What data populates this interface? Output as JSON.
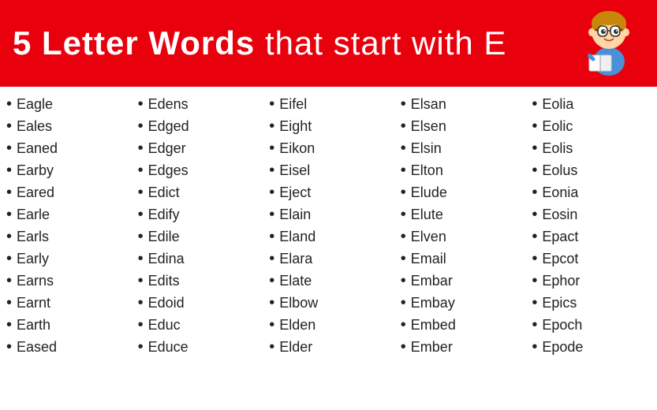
{
  "header": {
    "title_bold": "5 Letter Words",
    "title_normal": " that start with E"
  },
  "columns": [
    {
      "words": [
        "Eagle",
        "Eales",
        "Eaned",
        "Earby",
        "Eared",
        "Earle",
        "Earls",
        "Early",
        "Earns",
        "Earnt",
        "Earth",
        "Eased"
      ]
    },
    {
      "words": [
        "Edens",
        "Edged",
        "Edger",
        "Edges",
        "Edict",
        "Edify",
        "Edile",
        "Edina",
        "Edits",
        "Edoid",
        "Educ",
        "Educe"
      ]
    },
    {
      "words": [
        "Eifel",
        "Eight",
        "Eikon",
        "Eisel",
        "Eject",
        "Elain",
        "Eland",
        "Elara",
        "Elate",
        "Elbow",
        "Elden",
        "Elder"
      ]
    },
    {
      "words": [
        "Elsan",
        "Elsen",
        "Elsin",
        "Elton",
        "Elude",
        "Elute",
        "Elven",
        "Email",
        "Embar",
        "Embay",
        "Embed",
        "Ember"
      ]
    },
    {
      "words": [
        "Eolia",
        "Eolic",
        "Eolis",
        "Eolus",
        "Eonia",
        "Eosin",
        "Epact",
        "Epcot",
        "Ephor",
        "Epics",
        "Epoch",
        "Epode"
      ]
    }
  ]
}
